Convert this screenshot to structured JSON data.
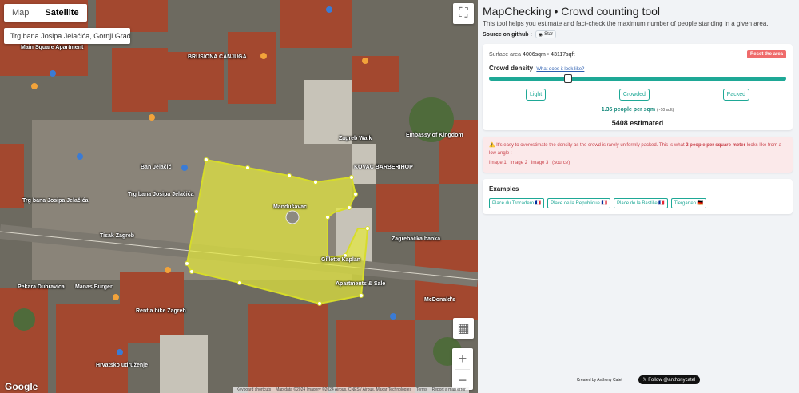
{
  "map": {
    "type_map": "Map",
    "type_satellite": "Satellite",
    "place_name": "Trg bana Josipa Jelačića, Gornji Grad - ...",
    "zoom_in": "+",
    "zoom_out": "−",
    "google": "Google",
    "attribution": [
      "Keyboard shortcuts",
      "Map data ©2024 Imagery ©2024 Airbus, CNES / Airbus, Maxar Technologies",
      "Terms",
      "Report a map error"
    ],
    "labels": [
      "Trg bana Josipa Jelačića",
      "Main Square Apartment",
      "BRUSIONA CANJUGA",
      "Mandušavac",
      "Trg bana Josipa Jelačića",
      "Zagrebačka banka",
      "Gillette Kaplan",
      "Apartments & Sale",
      "Tisak Zagreb",
      "Pekara Dubravica",
      "Manas Burger",
      "Hrvatsko udruženje",
      "Rent a bike Zagreb",
      "KOVAC BARBERIHOP",
      "Zagreb Walk",
      "McDonald's",
      "Embassy of Kingdom",
      "Ban Jelačić"
    ]
  },
  "panel": {
    "title": "MapChecking • Crowd counting tool",
    "subtitle": "This tool helps you estimate and fact-check the maximum number of people standing in a given area.",
    "source_label": "Source on github :",
    "star": "Star",
    "surface_label": "Surface area",
    "surface_value": "4006sqm • 43117sqft",
    "reset": "Reset the area",
    "density_label": "Crowd density",
    "density_link": "What does it look like?",
    "density_level": 0.26,
    "presets": [
      "Light",
      "Crowded",
      "Packed"
    ],
    "rate": "1.35 people per sqm",
    "rate_sqft": "(~10 sqft)",
    "estimate": "5408 estimated",
    "warning_pre": "⚠️ It's easy to overestimate the density as the crowd is rarely uniformly packed. This is what",
    "warning_bold": "2 people per square meter",
    "warning_post": "looks like from a low angle :",
    "warning_links": [
      "Image 1",
      "Image 2",
      "Image 3",
      "(source)"
    ],
    "examples_title": "Examples",
    "examples": [
      "Place du Trocadero 🇫🇷",
      "Place de la Republique 🇫🇷",
      "Place de la Bastille 🇫🇷",
      "Tiergarten 🇩🇪"
    ],
    "credit": "Created by Anthony Catel",
    "follow": "Follow @anthonycatel"
  }
}
